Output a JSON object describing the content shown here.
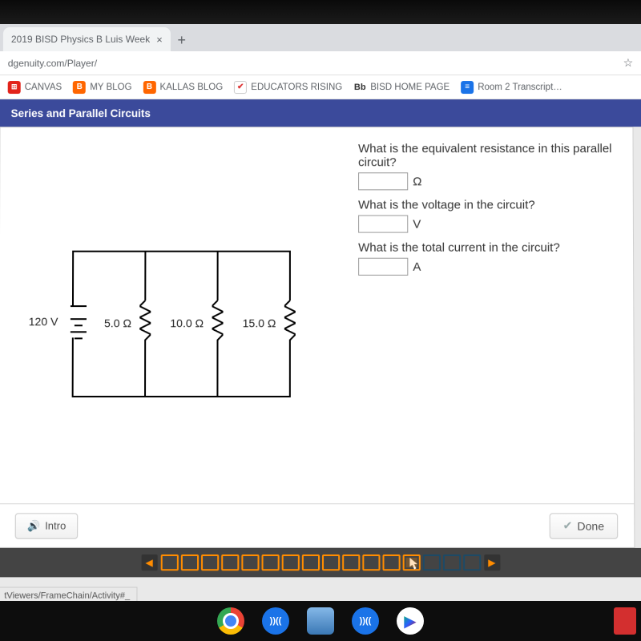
{
  "browser": {
    "tab_title": "2019 BISD Physics B Luis Week",
    "new_tab_symbol": "+",
    "close_symbol": "×",
    "address": "dgenuity.com/Player/",
    "star_symbol": "☆",
    "status_link": "tViewers/FrameChain/Activity#_"
  },
  "bookmarks": {
    "canvas": "CANVAS",
    "myblog": "MY BLOG",
    "kallas": "KALLAS BLOG",
    "edu": "EDUCATORS RISING",
    "bisd_prefix": "Bb",
    "bisd": "BISD HOME PAGE",
    "room2": "Room 2 Transcript…",
    "blog_icon_letter": "B"
  },
  "lesson": {
    "title": "Series and Parallel Circuits"
  },
  "circuit": {
    "source_label": "120 V",
    "r1": "5.0 Ω",
    "r2": "10.0 Ω",
    "r3": "15.0 Ω"
  },
  "questions": {
    "q1": "What is the equivalent resistance in this parallel circuit?",
    "u1": "Ω",
    "q2": "What is the voltage in the circuit?",
    "u2": "V",
    "q3": "What is the total current in the circuit?",
    "u3": "A"
  },
  "footer": {
    "intro": "Intro",
    "done": "Done",
    "check": "✔",
    "speaker": "🔊"
  },
  "progress": {
    "prev": "◀",
    "next": "▶",
    "total_boxes": 16,
    "current_index": 12
  },
  "taskbar": {
    "blue_label": "))((",
    "play_symbol": "▶"
  }
}
